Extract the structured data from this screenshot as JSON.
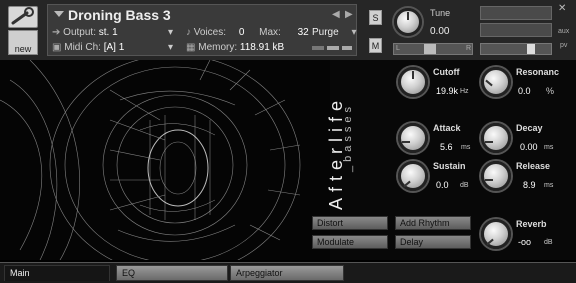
{
  "header": {
    "instrument_title": "Droning Bass 3",
    "output_label": "Output:",
    "output_value": "st. 1",
    "voices_label": "Voices:",
    "voices_value": "0",
    "max_label": "Max:",
    "max_value": "32",
    "purge_label": "Purge",
    "midi_label": "Midi Ch:",
    "midi_value": "[A]  1",
    "memory_label": "Memory:",
    "memory_value": "118.91 kB",
    "new_label": "new",
    "s_label": "S",
    "m_label": "M",
    "tune_label": "Tune",
    "tune_value": "0.00",
    "pan_left": "L",
    "pan_right": "R",
    "aux_label": "aux",
    "pv_label": "pv"
  },
  "instrument": {
    "brand": "Afterlife",
    "subtitle": "_basses"
  },
  "params": {
    "cutoff": {
      "label": "Cutoff",
      "value": "19.9k",
      "unit": "Hz"
    },
    "resonance": {
      "label": "Resonanc",
      "value": "0.0",
      "unit": "%"
    },
    "attack": {
      "label": "Attack",
      "value": "5.6",
      "unit": "ms"
    },
    "decay": {
      "label": "Decay",
      "value": "0.00",
      "unit": "ms"
    },
    "sustain": {
      "label": "Sustain",
      "value": "0.0",
      "unit": "dB"
    },
    "release": {
      "label": "Release",
      "value": "8.9",
      "unit": "ms"
    },
    "reverb": {
      "label": "Reverb",
      "value": "-oo",
      "unit": "dB"
    }
  },
  "fx_buttons": {
    "distort": "Distort",
    "add_rhythm": "Add Rhythm",
    "modulate": "Modulate",
    "delay": "Delay"
  },
  "tabs": {
    "main": "Main",
    "eq": "EQ",
    "arpeggiator": "Arpeggiator"
  },
  "colors": {
    "background": "#000000",
    "header": "#262626",
    "panel": "#3a3a3a",
    "button": "#7a7a7a",
    "text": "#dddddd"
  }
}
